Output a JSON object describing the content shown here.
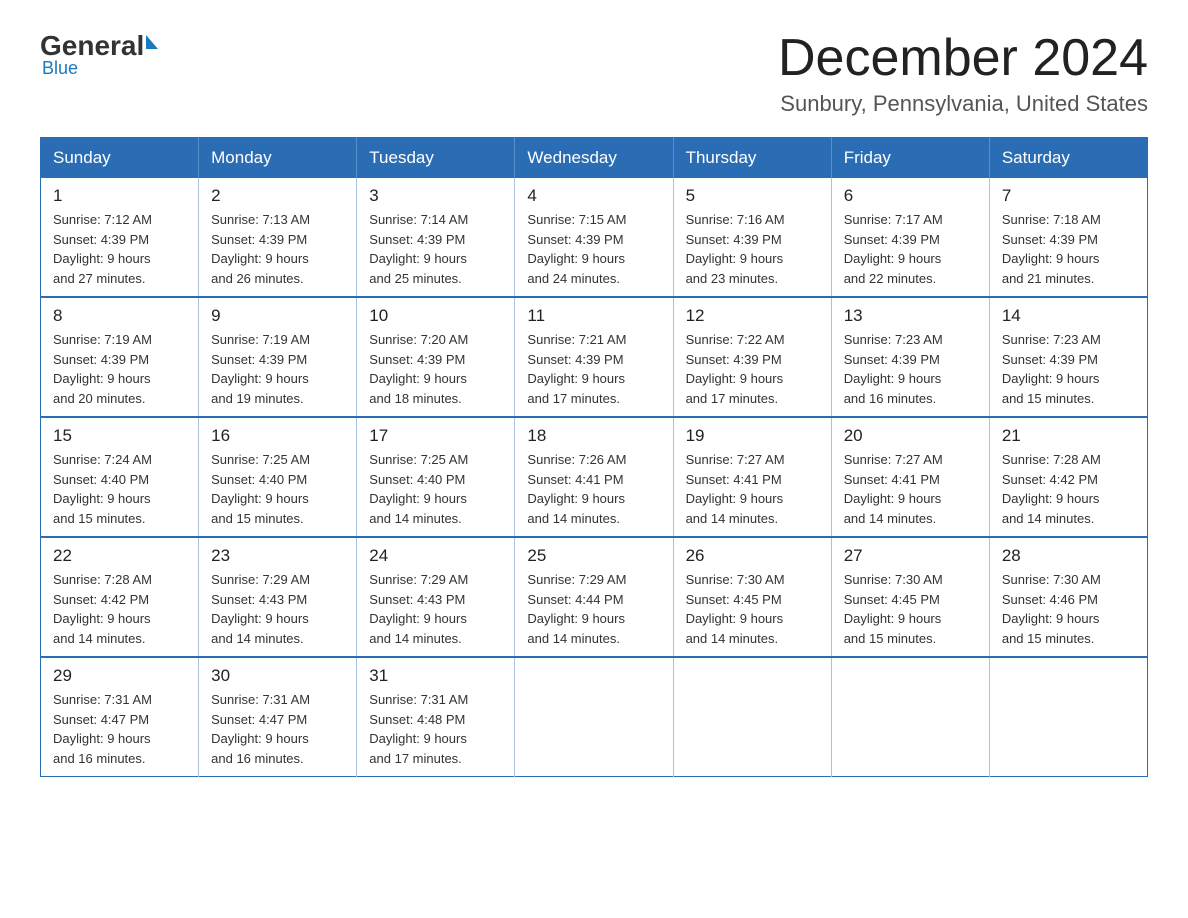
{
  "logo": {
    "general": "General",
    "blue": "Blue"
  },
  "header": {
    "month": "December 2024",
    "location": "Sunbury, Pennsylvania, United States"
  },
  "weekdays": [
    "Sunday",
    "Monday",
    "Tuesday",
    "Wednesday",
    "Thursday",
    "Friday",
    "Saturday"
  ],
  "weeks": [
    [
      {
        "day": "1",
        "sunrise": "7:12 AM",
        "sunset": "4:39 PM",
        "daylight": "9 hours and 27 minutes."
      },
      {
        "day": "2",
        "sunrise": "7:13 AM",
        "sunset": "4:39 PM",
        "daylight": "9 hours and 26 minutes."
      },
      {
        "day": "3",
        "sunrise": "7:14 AM",
        "sunset": "4:39 PM",
        "daylight": "9 hours and 25 minutes."
      },
      {
        "day": "4",
        "sunrise": "7:15 AM",
        "sunset": "4:39 PM",
        "daylight": "9 hours and 24 minutes."
      },
      {
        "day": "5",
        "sunrise": "7:16 AM",
        "sunset": "4:39 PM",
        "daylight": "9 hours and 23 minutes."
      },
      {
        "day": "6",
        "sunrise": "7:17 AM",
        "sunset": "4:39 PM",
        "daylight": "9 hours and 22 minutes."
      },
      {
        "day": "7",
        "sunrise": "7:18 AM",
        "sunset": "4:39 PM",
        "daylight": "9 hours and 21 minutes."
      }
    ],
    [
      {
        "day": "8",
        "sunrise": "7:19 AM",
        "sunset": "4:39 PM",
        "daylight": "9 hours and 20 minutes."
      },
      {
        "day": "9",
        "sunrise": "7:19 AM",
        "sunset": "4:39 PM",
        "daylight": "9 hours and 19 minutes."
      },
      {
        "day": "10",
        "sunrise": "7:20 AM",
        "sunset": "4:39 PM",
        "daylight": "9 hours and 18 minutes."
      },
      {
        "day": "11",
        "sunrise": "7:21 AM",
        "sunset": "4:39 PM",
        "daylight": "9 hours and 17 minutes."
      },
      {
        "day": "12",
        "sunrise": "7:22 AM",
        "sunset": "4:39 PM",
        "daylight": "9 hours and 17 minutes."
      },
      {
        "day": "13",
        "sunrise": "7:23 AM",
        "sunset": "4:39 PM",
        "daylight": "9 hours and 16 minutes."
      },
      {
        "day": "14",
        "sunrise": "7:23 AM",
        "sunset": "4:39 PM",
        "daylight": "9 hours and 15 minutes."
      }
    ],
    [
      {
        "day": "15",
        "sunrise": "7:24 AM",
        "sunset": "4:40 PM",
        "daylight": "9 hours and 15 minutes."
      },
      {
        "day": "16",
        "sunrise": "7:25 AM",
        "sunset": "4:40 PM",
        "daylight": "9 hours and 15 minutes."
      },
      {
        "day": "17",
        "sunrise": "7:25 AM",
        "sunset": "4:40 PM",
        "daylight": "9 hours and 14 minutes."
      },
      {
        "day": "18",
        "sunrise": "7:26 AM",
        "sunset": "4:41 PM",
        "daylight": "9 hours and 14 minutes."
      },
      {
        "day": "19",
        "sunrise": "7:27 AM",
        "sunset": "4:41 PM",
        "daylight": "9 hours and 14 minutes."
      },
      {
        "day": "20",
        "sunrise": "7:27 AM",
        "sunset": "4:41 PM",
        "daylight": "9 hours and 14 minutes."
      },
      {
        "day": "21",
        "sunrise": "7:28 AM",
        "sunset": "4:42 PM",
        "daylight": "9 hours and 14 minutes."
      }
    ],
    [
      {
        "day": "22",
        "sunrise": "7:28 AM",
        "sunset": "4:42 PM",
        "daylight": "9 hours and 14 minutes."
      },
      {
        "day": "23",
        "sunrise": "7:29 AM",
        "sunset": "4:43 PM",
        "daylight": "9 hours and 14 minutes."
      },
      {
        "day": "24",
        "sunrise": "7:29 AM",
        "sunset": "4:43 PM",
        "daylight": "9 hours and 14 minutes."
      },
      {
        "day": "25",
        "sunrise": "7:29 AM",
        "sunset": "4:44 PM",
        "daylight": "9 hours and 14 minutes."
      },
      {
        "day": "26",
        "sunrise": "7:30 AM",
        "sunset": "4:45 PM",
        "daylight": "9 hours and 14 minutes."
      },
      {
        "day": "27",
        "sunrise": "7:30 AM",
        "sunset": "4:45 PM",
        "daylight": "9 hours and 15 minutes."
      },
      {
        "day": "28",
        "sunrise": "7:30 AM",
        "sunset": "4:46 PM",
        "daylight": "9 hours and 15 minutes."
      }
    ],
    [
      {
        "day": "29",
        "sunrise": "7:31 AM",
        "sunset": "4:47 PM",
        "daylight": "9 hours and 16 minutes."
      },
      {
        "day": "30",
        "sunrise": "7:31 AM",
        "sunset": "4:47 PM",
        "daylight": "9 hours and 16 minutes."
      },
      {
        "day": "31",
        "sunrise": "7:31 AM",
        "sunset": "4:48 PM",
        "daylight": "9 hours and 17 minutes."
      },
      null,
      null,
      null,
      null
    ]
  ],
  "labels": {
    "sunrise": "Sunrise:",
    "sunset": "Sunset:",
    "daylight": "Daylight:"
  }
}
